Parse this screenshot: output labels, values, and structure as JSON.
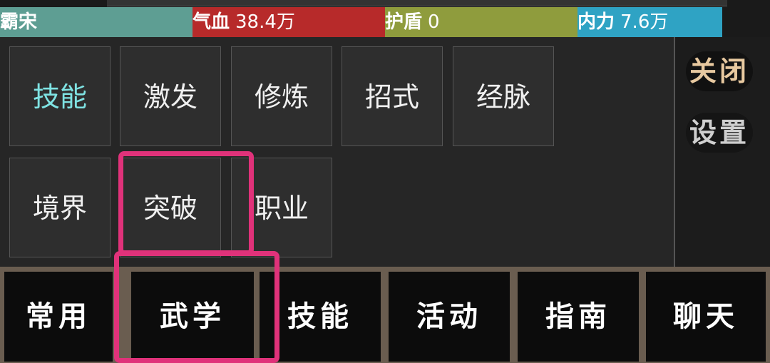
{
  "stats": {
    "name": "霸宋",
    "hp_label": "气血",
    "hp_value": "38.4万",
    "shield_label": "护盾",
    "shield_value": "0",
    "mp_label": "内力",
    "mp_value": "7.6万"
  },
  "skill_menu": {
    "row1": [
      "技能",
      "激发",
      "修炼",
      "招式",
      "经脉"
    ],
    "row2": [
      "境界",
      "突破",
      "职业"
    ],
    "active": "技能"
  },
  "side": {
    "close": "关闭",
    "settings": "设置"
  },
  "tabs": [
    "常用",
    "武学",
    "技能",
    "活动",
    "指南",
    "聊天"
  ],
  "colors": {
    "name_bar": "#5e9e93",
    "hp_bar": "#b72a2a",
    "shield_bar": "#8f9c3d",
    "mp_bar": "#2fa3c4",
    "highlight": "#e0327a",
    "active_text": "#7fe3e3"
  }
}
